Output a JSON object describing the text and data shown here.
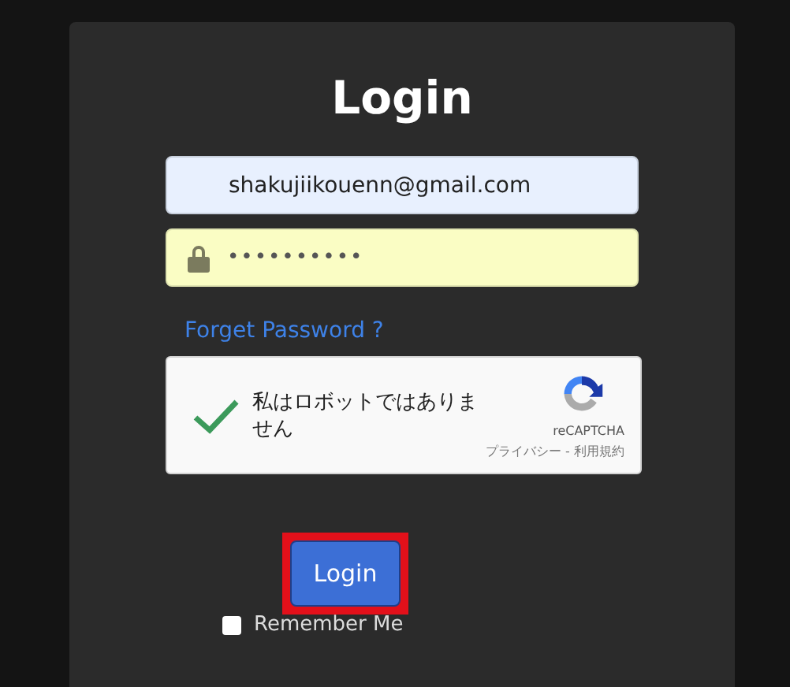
{
  "title": "Login",
  "email": {
    "value": "shakujiikouenn@gmail.com"
  },
  "password": {
    "value": "••••••••••"
  },
  "forgot_link": "Forget Password ?",
  "captcha": {
    "label": "私はロボットではありません",
    "checked": true,
    "brand": "reCAPTCHA",
    "links": "プライバシー - 利用規約"
  },
  "login_button": {
    "label": "Login",
    "highlighted": true
  },
  "remember": {
    "label": "Remember Me",
    "checked": false
  }
}
